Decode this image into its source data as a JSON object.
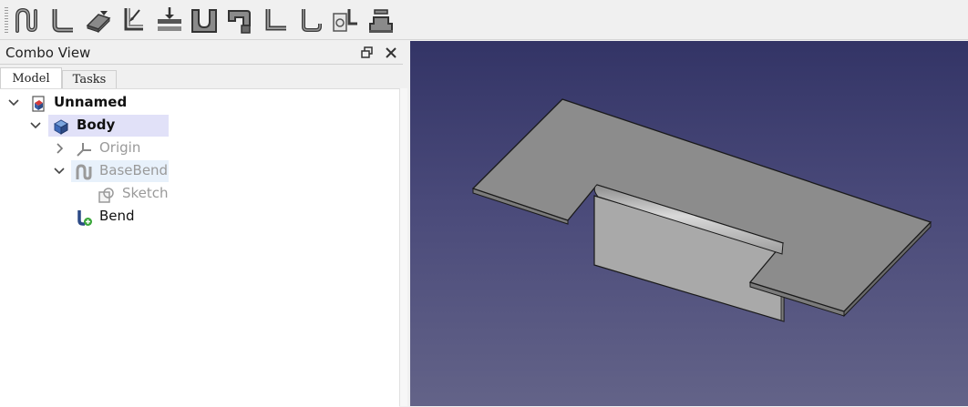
{
  "toolbar": {
    "buttons": [
      {
        "name": "base-bend-icon"
      },
      {
        "name": "add-bend-icon"
      },
      {
        "name": "extend-face-icon"
      },
      {
        "name": "add-junction-icon"
      },
      {
        "name": "relief-bend-icon"
      },
      {
        "name": "add-wall-icon"
      },
      {
        "name": "add-return-icon"
      },
      {
        "name": "add-step-icon"
      },
      {
        "name": "add-jog-icon"
      },
      {
        "name": "unfold-icon"
      },
      {
        "name": "sketch-on-sheet-icon"
      }
    ]
  },
  "combo_view": {
    "title": "Combo View",
    "tabs": [
      "Model",
      "Tasks"
    ],
    "active_tab": "Model"
  },
  "tree": {
    "items": [
      {
        "label": "Unnamed",
        "icon": "document-icon",
        "expanded": true
      },
      {
        "label": "Body",
        "icon": "body-icon",
        "expanded": true,
        "selected": true
      },
      {
        "label": "Origin",
        "icon": "origin-icon",
        "expanded": false,
        "dimmed": true
      },
      {
        "label": "BaseBend",
        "icon": "base-bend-icon",
        "expanded": true,
        "dimmed": true,
        "hover": true
      },
      {
        "label": "Sketch",
        "icon": "sketch-icon",
        "dimmed": true
      },
      {
        "label": "Bend",
        "icon": "bend-feature-icon"
      }
    ]
  },
  "colors": {
    "selection": "#e1e1f8",
    "hover": "#e8f1fb",
    "viewport_top": "#333466",
    "viewport_bottom": "#636388",
    "part_face": "#8c8c8c"
  }
}
